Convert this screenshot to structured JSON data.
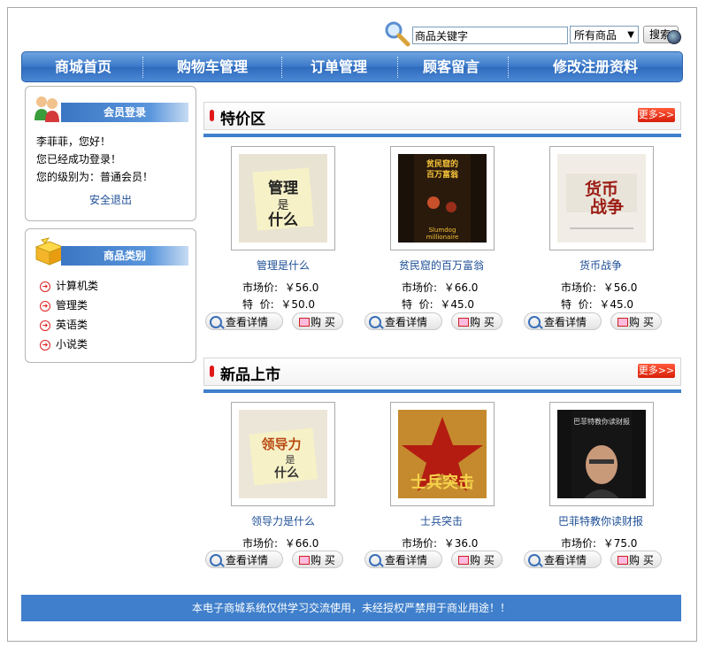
{
  "search": {
    "placeholder": "商品关键字",
    "value": "商品关键字",
    "category_selected": "所有商品",
    "button_label": "搜索"
  },
  "nav": {
    "items": [
      "商城首页",
      "购物车管理",
      "订单管理",
      "顾客留言",
      "修改注册资料"
    ]
  },
  "member": {
    "title": "会员登录",
    "greeting": "李菲菲，您好！",
    "status": "您已经成功登录！",
    "level": "您的级别为：普通会员！",
    "logout_label": "安全退出"
  },
  "categories": {
    "title": "商品类别",
    "items": [
      "计算机类",
      "管理类",
      "英语类",
      "小说类"
    ]
  },
  "sections": [
    {
      "title": "特价区",
      "more_label": "更多>>",
      "products": [
        {
          "name": "管理是什么",
          "cover_text": "管理是什么",
          "market_label": "市场价:",
          "market_price": "￥56.0",
          "special_label": "特  价:",
          "special_price": "￥50.0"
        },
        {
          "name": "贫民窟的百万富翁",
          "cover_text": "贫民窟的百万富翁",
          "market_label": "市场价:",
          "market_price": "￥66.0",
          "special_label": "特  价:",
          "special_price": "￥45.0"
        },
        {
          "name": "货币战争",
          "cover_text": "货币战争",
          "market_label": "市场价:",
          "market_price": "￥56.0",
          "special_label": "特  价:",
          "special_price": "￥45.0"
        }
      ]
    },
    {
      "title": "新品上市",
      "more_label": "更多>>",
      "products": [
        {
          "name": "领导力是什么",
          "cover_text": "领导力是什么",
          "market_label": "市场价:",
          "market_price": "￥66.0"
        },
        {
          "name": "士兵突击",
          "cover_text": "士兵突击",
          "market_label": "市场价:",
          "market_price": "￥36.0"
        },
        {
          "name": "巴菲特教你读财报",
          "cover_text": "巴菲特教你读财报",
          "market_label": "市场价:",
          "market_price": "￥75.0"
        }
      ]
    }
  ],
  "buttons": {
    "detail_label": "查看详情",
    "buy_label": "购 买"
  },
  "footer": {
    "text": "本电子商城系统仅供学习交流使用，未经授权严禁用于商业用途！！"
  },
  "colors": {
    "nav_blue": "#3a78c8",
    "section_line": "#3f7fcb",
    "link": "#1e4f96",
    "more_red": "#d71e0a"
  }
}
